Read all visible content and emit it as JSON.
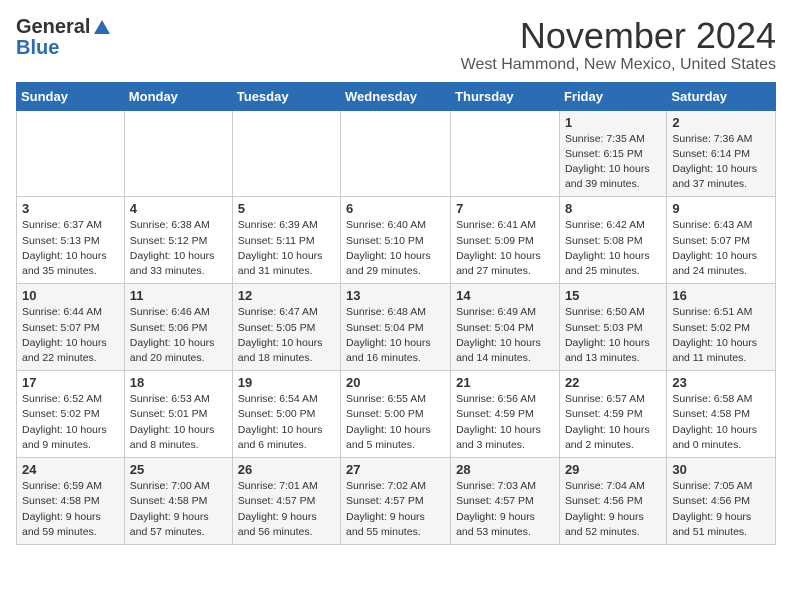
{
  "header": {
    "logo_general": "General",
    "logo_blue": "Blue",
    "month": "November 2024",
    "location": "West Hammond, New Mexico, United States"
  },
  "days_of_week": [
    "Sunday",
    "Monday",
    "Tuesday",
    "Wednesday",
    "Thursday",
    "Friday",
    "Saturday"
  ],
  "weeks": [
    [
      null,
      null,
      null,
      null,
      null,
      {
        "day": 1,
        "sunrise": "7:35 AM",
        "sunset": "6:15 PM",
        "daylight": "10 hours and 39 minutes."
      },
      {
        "day": 2,
        "sunrise": "7:36 AM",
        "sunset": "6:14 PM",
        "daylight": "10 hours and 37 minutes."
      }
    ],
    [
      {
        "day": 3,
        "sunrise": "6:37 AM",
        "sunset": "5:13 PM",
        "daylight": "10 hours and 35 minutes."
      },
      {
        "day": 4,
        "sunrise": "6:38 AM",
        "sunset": "5:12 PM",
        "daylight": "10 hours and 33 minutes."
      },
      {
        "day": 5,
        "sunrise": "6:39 AM",
        "sunset": "5:11 PM",
        "daylight": "10 hours and 31 minutes."
      },
      {
        "day": 6,
        "sunrise": "6:40 AM",
        "sunset": "5:10 PM",
        "daylight": "10 hours and 29 minutes."
      },
      {
        "day": 7,
        "sunrise": "6:41 AM",
        "sunset": "5:09 PM",
        "daylight": "10 hours and 27 minutes."
      },
      {
        "day": 8,
        "sunrise": "6:42 AM",
        "sunset": "5:08 PM",
        "daylight": "10 hours and 25 minutes."
      },
      {
        "day": 9,
        "sunrise": "6:43 AM",
        "sunset": "5:07 PM",
        "daylight": "10 hours and 24 minutes."
      }
    ],
    [
      {
        "day": 10,
        "sunrise": "6:44 AM",
        "sunset": "5:07 PM",
        "daylight": "10 hours and 22 minutes."
      },
      {
        "day": 11,
        "sunrise": "6:46 AM",
        "sunset": "5:06 PM",
        "daylight": "10 hours and 20 minutes."
      },
      {
        "day": 12,
        "sunrise": "6:47 AM",
        "sunset": "5:05 PM",
        "daylight": "10 hours and 18 minutes."
      },
      {
        "day": 13,
        "sunrise": "6:48 AM",
        "sunset": "5:04 PM",
        "daylight": "10 hours and 16 minutes."
      },
      {
        "day": 14,
        "sunrise": "6:49 AM",
        "sunset": "5:04 PM",
        "daylight": "10 hours and 14 minutes."
      },
      {
        "day": 15,
        "sunrise": "6:50 AM",
        "sunset": "5:03 PM",
        "daylight": "10 hours and 13 minutes."
      },
      {
        "day": 16,
        "sunrise": "6:51 AM",
        "sunset": "5:02 PM",
        "daylight": "10 hours and 11 minutes."
      }
    ],
    [
      {
        "day": 17,
        "sunrise": "6:52 AM",
        "sunset": "5:02 PM",
        "daylight": "10 hours and 9 minutes."
      },
      {
        "day": 18,
        "sunrise": "6:53 AM",
        "sunset": "5:01 PM",
        "daylight": "10 hours and 8 minutes."
      },
      {
        "day": 19,
        "sunrise": "6:54 AM",
        "sunset": "5:00 PM",
        "daylight": "10 hours and 6 minutes."
      },
      {
        "day": 20,
        "sunrise": "6:55 AM",
        "sunset": "5:00 PM",
        "daylight": "10 hours and 5 minutes."
      },
      {
        "day": 21,
        "sunrise": "6:56 AM",
        "sunset": "4:59 PM",
        "daylight": "10 hours and 3 minutes."
      },
      {
        "day": 22,
        "sunrise": "6:57 AM",
        "sunset": "4:59 PM",
        "daylight": "10 hours and 2 minutes."
      },
      {
        "day": 23,
        "sunrise": "6:58 AM",
        "sunset": "4:58 PM",
        "daylight": "10 hours and 0 minutes."
      }
    ],
    [
      {
        "day": 24,
        "sunrise": "6:59 AM",
        "sunset": "4:58 PM",
        "daylight": "9 hours and 59 minutes."
      },
      {
        "day": 25,
        "sunrise": "7:00 AM",
        "sunset": "4:58 PM",
        "daylight": "9 hours and 57 minutes."
      },
      {
        "day": 26,
        "sunrise": "7:01 AM",
        "sunset": "4:57 PM",
        "daylight": "9 hours and 56 minutes."
      },
      {
        "day": 27,
        "sunrise": "7:02 AM",
        "sunset": "4:57 PM",
        "daylight": "9 hours and 55 minutes."
      },
      {
        "day": 28,
        "sunrise": "7:03 AM",
        "sunset": "4:57 PM",
        "daylight": "9 hours and 53 minutes."
      },
      {
        "day": 29,
        "sunrise": "7:04 AM",
        "sunset": "4:56 PM",
        "daylight": "9 hours and 52 minutes."
      },
      {
        "day": 30,
        "sunrise": "7:05 AM",
        "sunset": "4:56 PM",
        "daylight": "9 hours and 51 minutes."
      }
    ]
  ]
}
